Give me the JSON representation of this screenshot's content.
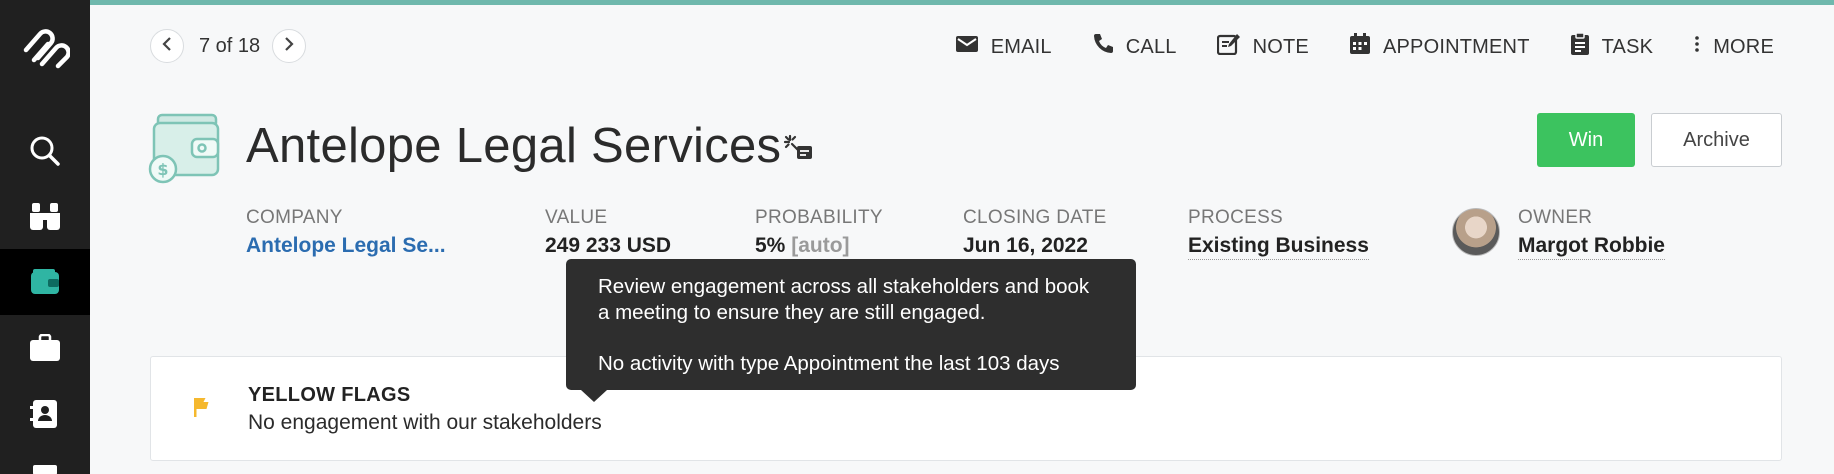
{
  "pager": {
    "text": "7 of 18"
  },
  "actions": [
    {
      "label": "EMAIL",
      "icon": "email-icon"
    },
    {
      "label": "CALL",
      "icon": "phone-icon"
    },
    {
      "label": "NOTE",
      "icon": "note-icon"
    },
    {
      "label": "APPOINTMENT",
      "icon": "calendar-icon"
    },
    {
      "label": "TASK",
      "icon": "clipboard-icon"
    },
    {
      "label": "MORE",
      "icon": "more-vertical-icon"
    }
  ],
  "deal": {
    "title": "Antelope Legal Services",
    "win_label": "Win",
    "archive_label": "Archive"
  },
  "fields": {
    "company": {
      "label": "COMPANY",
      "value": "Antelope Legal Se..."
    },
    "value": {
      "label": "VALUE",
      "value": "249 233 USD"
    },
    "probability": {
      "label": "PROBABILITY",
      "value": "5%",
      "suffix": "[auto]"
    },
    "closing_date": {
      "label": "CLOSING DATE",
      "value": "Jun 16, 2022"
    },
    "process": {
      "label": "PROCESS",
      "value": "Existing Business"
    },
    "owner": {
      "label": "OWNER",
      "value": "Margot Robbie"
    }
  },
  "flags": {
    "title": "YELLOW FLAGS",
    "text": "No engagement with our stakeholders"
  },
  "tooltip": {
    "line1": "Review engagement across all stakeholders and book a meeting to ensure they are still engaged.",
    "line2": "No activity with type Appointment the last 103 days"
  },
  "sidebar": {
    "items": [
      "search-icon",
      "binoculars-icon",
      "wallet-icon",
      "briefcase-icon",
      "contacts-icon"
    ]
  },
  "colors": {
    "accent": "#6fb8ad",
    "sidebar": "#202020",
    "win": "#3cc35f",
    "link": "#2b6cb0",
    "flag": "#f5b82e",
    "tooltip": "#2e2e2e"
  }
}
